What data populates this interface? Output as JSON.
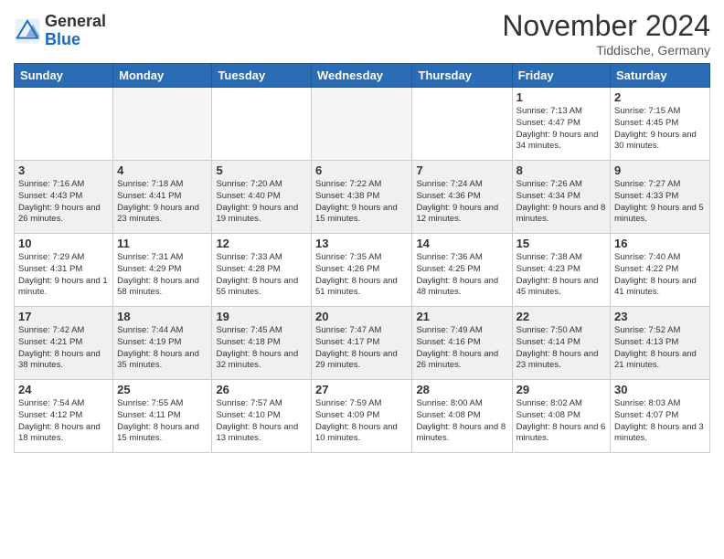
{
  "header": {
    "title": "November 2024",
    "location": "Tiddische, Germany",
    "logo_general": "General",
    "logo_blue": "Blue"
  },
  "columns": [
    "Sunday",
    "Monday",
    "Tuesday",
    "Wednesday",
    "Thursday",
    "Friday",
    "Saturday"
  ],
  "weeks": [
    {
      "alt": false,
      "days": [
        {
          "date": "",
          "info": ""
        },
        {
          "date": "",
          "info": ""
        },
        {
          "date": "",
          "info": ""
        },
        {
          "date": "",
          "info": ""
        },
        {
          "date": "",
          "info": ""
        },
        {
          "date": "1",
          "info": "Sunrise: 7:13 AM\nSunset: 4:47 PM\nDaylight: 9 hours and 34 minutes."
        },
        {
          "date": "2",
          "info": "Sunrise: 7:15 AM\nSunset: 4:45 PM\nDaylight: 9 hours and 30 minutes."
        }
      ]
    },
    {
      "alt": true,
      "days": [
        {
          "date": "3",
          "info": "Sunrise: 7:16 AM\nSunset: 4:43 PM\nDaylight: 9 hours and 26 minutes."
        },
        {
          "date": "4",
          "info": "Sunrise: 7:18 AM\nSunset: 4:41 PM\nDaylight: 9 hours and 23 minutes."
        },
        {
          "date": "5",
          "info": "Sunrise: 7:20 AM\nSunset: 4:40 PM\nDaylight: 9 hours and 19 minutes."
        },
        {
          "date": "6",
          "info": "Sunrise: 7:22 AM\nSunset: 4:38 PM\nDaylight: 9 hours and 15 minutes."
        },
        {
          "date": "7",
          "info": "Sunrise: 7:24 AM\nSunset: 4:36 PM\nDaylight: 9 hours and 12 minutes."
        },
        {
          "date": "8",
          "info": "Sunrise: 7:26 AM\nSunset: 4:34 PM\nDaylight: 9 hours and 8 minutes."
        },
        {
          "date": "9",
          "info": "Sunrise: 7:27 AM\nSunset: 4:33 PM\nDaylight: 9 hours and 5 minutes."
        }
      ]
    },
    {
      "alt": false,
      "days": [
        {
          "date": "10",
          "info": "Sunrise: 7:29 AM\nSunset: 4:31 PM\nDaylight: 9 hours and 1 minute."
        },
        {
          "date": "11",
          "info": "Sunrise: 7:31 AM\nSunset: 4:29 PM\nDaylight: 8 hours and 58 minutes."
        },
        {
          "date": "12",
          "info": "Sunrise: 7:33 AM\nSunset: 4:28 PM\nDaylight: 8 hours and 55 minutes."
        },
        {
          "date": "13",
          "info": "Sunrise: 7:35 AM\nSunset: 4:26 PM\nDaylight: 8 hours and 51 minutes."
        },
        {
          "date": "14",
          "info": "Sunrise: 7:36 AM\nSunset: 4:25 PM\nDaylight: 8 hours and 48 minutes."
        },
        {
          "date": "15",
          "info": "Sunrise: 7:38 AM\nSunset: 4:23 PM\nDaylight: 8 hours and 45 minutes."
        },
        {
          "date": "16",
          "info": "Sunrise: 7:40 AM\nSunset: 4:22 PM\nDaylight: 8 hours and 41 minutes."
        }
      ]
    },
    {
      "alt": true,
      "days": [
        {
          "date": "17",
          "info": "Sunrise: 7:42 AM\nSunset: 4:21 PM\nDaylight: 8 hours and 38 minutes."
        },
        {
          "date": "18",
          "info": "Sunrise: 7:44 AM\nSunset: 4:19 PM\nDaylight: 8 hours and 35 minutes."
        },
        {
          "date": "19",
          "info": "Sunrise: 7:45 AM\nSunset: 4:18 PM\nDaylight: 8 hours and 32 minutes."
        },
        {
          "date": "20",
          "info": "Sunrise: 7:47 AM\nSunset: 4:17 PM\nDaylight: 8 hours and 29 minutes."
        },
        {
          "date": "21",
          "info": "Sunrise: 7:49 AM\nSunset: 4:16 PM\nDaylight: 8 hours and 26 minutes."
        },
        {
          "date": "22",
          "info": "Sunrise: 7:50 AM\nSunset: 4:14 PM\nDaylight: 8 hours and 23 minutes."
        },
        {
          "date": "23",
          "info": "Sunrise: 7:52 AM\nSunset: 4:13 PM\nDaylight: 8 hours and 21 minutes."
        }
      ]
    },
    {
      "alt": false,
      "days": [
        {
          "date": "24",
          "info": "Sunrise: 7:54 AM\nSunset: 4:12 PM\nDaylight: 8 hours and 18 minutes."
        },
        {
          "date": "25",
          "info": "Sunrise: 7:55 AM\nSunset: 4:11 PM\nDaylight: 8 hours and 15 minutes."
        },
        {
          "date": "26",
          "info": "Sunrise: 7:57 AM\nSunset: 4:10 PM\nDaylight: 8 hours and 13 minutes."
        },
        {
          "date": "27",
          "info": "Sunrise: 7:59 AM\nSunset: 4:09 PM\nDaylight: 8 hours and 10 minutes."
        },
        {
          "date": "28",
          "info": "Sunrise: 8:00 AM\nSunset: 4:08 PM\nDaylight: 8 hours and 8 minutes."
        },
        {
          "date": "29",
          "info": "Sunrise: 8:02 AM\nSunset: 4:08 PM\nDaylight: 8 hours and 6 minutes."
        },
        {
          "date": "30",
          "info": "Sunrise: 8:03 AM\nSunset: 4:07 PM\nDaylight: 8 hours and 3 minutes."
        }
      ]
    }
  ]
}
